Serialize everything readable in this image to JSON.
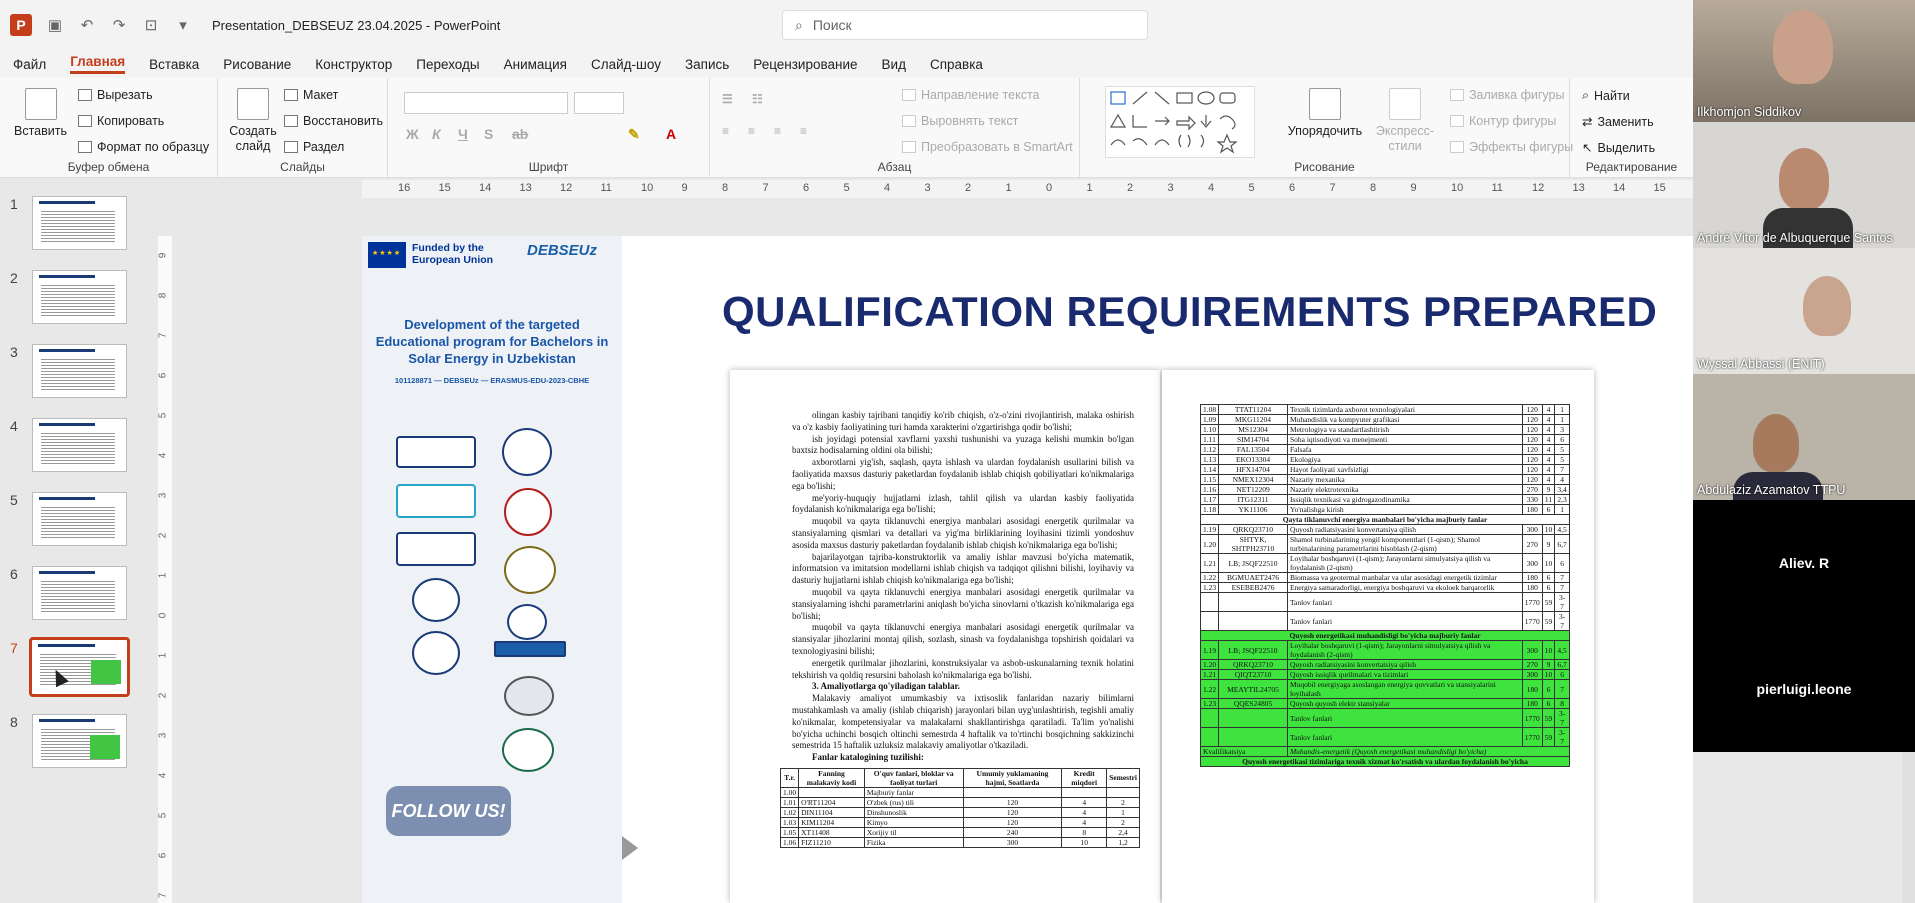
{
  "window": {
    "app_title": "Presentation_DEBSEUZ 23.04.2025  -  PowerPoint",
    "search_placeholder": "Поиск"
  },
  "menu": [
    "Файл",
    "Главная",
    "Вставка",
    "Рисование",
    "Конструктор",
    "Переходы",
    "Анимация",
    "Слайд-шоу",
    "Запись",
    "Рецензирование",
    "Вид",
    "Справка"
  ],
  "ribbon": {
    "clipboard": {
      "paste": "Вставить",
      "cut": "Вырезать",
      "copy": "Копировать",
      "format_painter": "Формат по образцу",
      "group": "Буфер обмена"
    },
    "slides": {
      "new_slide": "Создать слайд",
      "layout": "Макет",
      "reset": "Восстановить",
      "section": "Раздел",
      "group": "Слайды"
    },
    "font": {
      "group": "Шрифт"
    },
    "paragraph": {
      "text_direction": "Направление текста",
      "align_text": "Выровнять текст",
      "smartart": "Преобразовать в SmartArt",
      "group": "Абзац"
    },
    "drawing": {
      "arrange": "Упорядочить",
      "quick_styles": "Экспресс-стили",
      "shape_fill": "Заливка фигуры",
      "shape_outline": "Контур фигуры",
      "shape_effects": "Эффекты фигуры",
      "group": "Рисование"
    },
    "editing": {
      "find": "Найти",
      "replace": "Заменить",
      "select": "Выделить",
      "group": "Редактирование"
    }
  },
  "ruler_h": [
    "16",
    "15",
    "14",
    "13",
    "12",
    "11",
    "10",
    "9",
    "8",
    "7",
    "6",
    "5",
    "4",
    "3",
    "2",
    "1",
    "0",
    "1",
    "2",
    "3",
    "4",
    "5",
    "6",
    "7",
    "8",
    "9",
    "10",
    "11",
    "12",
    "13",
    "14",
    "15",
    "16"
  ],
  "ruler_v": [
    "9",
    "8",
    "7",
    "6",
    "5",
    "4",
    "3",
    "2",
    "1",
    "0",
    "1",
    "2",
    "3",
    "4",
    "5",
    "6",
    "7"
  ],
  "thumbnails": [
    "1",
    "2",
    "3",
    "4",
    "5",
    "6",
    "7",
    "8"
  ],
  "selected_slide": "7",
  "slide": {
    "funded": "Funded by the European Union",
    "brand": "DEBSEUz",
    "project_title": "Development of the targeted Educational program for Bachelors in Solar Energy in Uzbekistan",
    "project_code": "101128871 — DEBSEUz — ERASMUS-EDU-2023-CBHE",
    "follow": "FOLLOW US!",
    "heading": "QUALIFICATION REQUIREMENTS PREPARED",
    "doc_paragraphs": [
      "olingan kasbiy tajribani tanqidiy ko'rib chiqish, o'z-o'zini rivojlantirish, malaka oshirish va o'z kasbiy faoliyatining turi hamda xarakterini o'zgartirishga qodir bo'lishi;",
      "ish joyidagi potensial xavflarni yaxshi tushunishi va yuzaga kelishi mumkin bo'lgan baxtsiz hodisalarning oldini ola bilishi;",
      "axborotlarni yig'ish, saqlash, qayta ishlash va ulardan foydalanish usullarini bilish va faoliyatida maxsus dasturiy paketlardan foydalanib ishlab chiqish qobiliyatlari ko'nikmalariga ega bo'lishi;",
      "me'yoriy-huquqiy hujjatlarni izlash, tahlil qilish va ulardan kasbiy faoliyatida foydalanish ko'nikmalariga ega bo'lishi;",
      "muqobil va qayta tiklanuvchi energiya manbalari asosidagi energetik qurilmalar va stansiyalarning qismlari va detallari va yig'ma birliklarining loyihasini tizimli yondoshuv asosida maxsus dasturiy paketlardan foydalanib ishlab chiqish ko'nikmalariga ega bo'lishi;",
      "bajarilayotgan tajriba-konstruktorlik va amaliy ishlar mavzusi bo'yicha matematik, informatsion va imitatsion modellarni ishlab chiqish va tadqiqot qilishni bilishi, loyihaviy va dasturiy hujjatlarni ishlab chiqish ko'nikmalariga ega bo'lishi;",
      "muqobil va qayta tiklanuvchi energiya manbalari asosidagi energetik qurilmalar va stansiyalarning ishchi parametrlarini aniqlash bo'yicha sinovlarni o'tkazish ko'nikmalariga ega bo'lishi;",
      "muqobil va qayta tiklanuvchi energiya manbalari asosidagi energetik qurilmalar va stansiyalar jihozlarini montaj qilish, sozlash, sinash va foydalanishga topshirish qoidalari va texnologiyasini bilishi;",
      "energetik qurilmalar jihozlarini, konstruksiyalar va asbob-uskunalarning texnik holatini tekshirish va qoldiq resursini baholash ko'nikmalariga ega bo'lishi."
    ],
    "doc_section": "3. Amaliyotlarga qo'yiladigan talablar.",
    "doc_para2": "Malakaviy amaliyot umumkasbiy va ixtisoslik fanlaridan nazariy bilimlarni mustahkamlash va amaliy (ishlab chiqarish) jarayonlari bilan uyg'unlashtirish, tegishli amaliy ko'nikmalar, kompetensiyalar va malakalarni shakllantirishga qaratiladi. Ta'lim yo'nalishi bo'yicha uchinchi bosqich oltinchi semestrda 4 haftalik va to'rtinchi bosqichning sakkizinchi semestrida 15 haftalik uzluksiz malakaviy amaliyotlar o'tkaziladi.",
    "doc_catalog": "Fanlar katalogining tuzilishi:",
    "doc_table_headers": [
      "T.r.",
      "Fanning malakaviy kodi",
      "O'quv fanlari, bloklar va faoliyat turlari",
      "Umumiy yuklamaning hajmi, Soatlarda",
      "Kredit miqdori",
      "Semestri"
    ],
    "doc_table_rows": [
      [
        "1.00",
        "",
        "Majburiy fanlar",
        "",
        "",
        ""
      ],
      [
        "1.01",
        "O'RT11204",
        "O'zbek (rus) tili",
        "120",
        "4",
        "2"
      ],
      [
        "1.02",
        "DIN11104",
        "Dinshunoslik",
        "120",
        "4",
        "1"
      ],
      [
        "1.03",
        "KIM11204",
        "Kimyo",
        "120",
        "4",
        "2"
      ],
      [
        "1.05",
        "XT11408",
        "Xorijiy til",
        "240",
        "8",
        "2,4"
      ],
      [
        "1.06",
        "FIZ11210",
        "Fizika",
        "300",
        "10",
        "1,2"
      ]
    ],
    "table2_rows": [
      {
        "n": "1.08",
        "code": "TTAT11204",
        "name": "Texnik tizimlarda axborot texnologiyalari",
        "h": "120",
        "c": "4",
        "s": "1"
      },
      {
        "n": "1.09",
        "code": "MKG11204",
        "name": "Muhandislik va kompyuter grafikasi",
        "h": "120",
        "c": "4",
        "s": "1"
      },
      {
        "n": "1.10",
        "code": "MS12304",
        "name": "Metrologiya va standartlashtirish",
        "h": "120",
        "c": "4",
        "s": "3"
      },
      {
        "n": "1.11",
        "code": "SIM14704",
        "name": "Soha iqtisodiyoti va menejmenti",
        "h": "120",
        "c": "4",
        "s": "6"
      },
      {
        "n": "1.12",
        "code": "FAL13504",
        "name": "Falsafa",
        "h": "120",
        "c": "4",
        "s": "5"
      },
      {
        "n": "1.13",
        "code": "EKO13304",
        "name": "Ekologiya",
        "h": "120",
        "c": "4",
        "s": "5"
      },
      {
        "n": "1.14",
        "code": "HFX14704",
        "name": "Hayot faoliyati xavfsizligi",
        "h": "120",
        "c": "4",
        "s": "7"
      },
      {
        "n": "1.15",
        "code": "NMEX12304",
        "name": "Nazariy mexanika",
        "h": "120",
        "c": "4",
        "s": "4"
      },
      {
        "n": "1.16",
        "code": "NET12209",
        "name": "Nazariy elektrotexnika",
        "h": "270",
        "c": "9",
        "s": "3,4"
      },
      {
        "n": "1.17",
        "code": "ITG12311",
        "name": "Issiqlik texnikasi va gidrogazodinamika",
        "h": "330",
        "c": "11",
        "s": "2,3"
      },
      {
        "n": "1.18",
        "code": "YK11106",
        "name": "Yo'nalishga kirish",
        "h": "180",
        "c": "6",
        "s": "1"
      }
    ],
    "table2_section1": "Qayta tiklanuvchi energiya manbalari bo'yicha majburiy fanlar",
    "table2_rows_b": [
      {
        "n": "1.19",
        "code": "QRKQ23710",
        "name": "Quyosh radiatsiyasini konvertatsiya qilish",
        "h": "300",
        "c": "10",
        "s": "4,5"
      },
      {
        "n": "1.20",
        "code": "SHTYK, SHTPH23710",
        "name": "Shamol turbinalarining yengil komponentlari (1-qism); Shamol turbinalarining parametrlarini hisoblash (2-qism)",
        "h": "270",
        "c": "9",
        "s": "6,7"
      },
      {
        "n": "1.21",
        "code": "LB; JSQF22510",
        "name": "Loyihalar boshqaruvi (1-qism); Jarayonlarni simulyatsiya qilish va foydalanish (2-qism)",
        "h": "300",
        "c": "10",
        "s": "6"
      },
      {
        "n": "1.22",
        "code": "BGMUAET2476",
        "name": "Biomassa va geotermal manbalar va ular asosidagi energetik tizimlar",
        "h": "180",
        "c": "6",
        "s": "7"
      },
      {
        "n": "1.23",
        "code": "ESEBEB2476",
        "name": "Energiya samaradorligi, energiya boshqaruvi va ekoloek barqarorlik",
        "h": "180",
        "c": "6",
        "s": "7"
      },
      {
        "n": "",
        "code": "",
        "name": "Tanlov fanlari",
        "h": "1770",
        "c": "59",
        "s": "3-7"
      },
      {
        "n": "",
        "code": "",
        "name": "Tanlov fanlari",
        "h": "1770",
        "c": "59",
        "s": "3-7"
      }
    ],
    "table2_section2": "Quyosh energetikasi muhandisligi bo'yicha majburiy fanlar",
    "table2_rows_green": [
      {
        "n": "1.19",
        "code": "LB; JSQF22510",
        "name": "Loyihalar boshqaruvi (1-qism); Jarayonlarni simulyatsiya qilish va foydalanish (2-qism)",
        "h": "300",
        "c": "10",
        "s": "4,5"
      },
      {
        "n": "1.20",
        "code": "QRKQ23710",
        "name": "Quyosh radiatsiyasini konvertatsiya qilish",
        "h": "270",
        "c": "9",
        "s": "6,7"
      },
      {
        "n": "1.21",
        "code": "QIQT23710",
        "name": "Quyosh issiqlik qurilmalari va tizimlari",
        "h": "300",
        "c": "10",
        "s": "6"
      },
      {
        "n": "1.22",
        "code": "MEAYTIL24705",
        "name": "Muqobil energiyaga asoslangan energiya quvvatlari va stansiyalarini loyihalash",
        "h": "180",
        "c": "6",
        "s": "7"
      },
      {
        "n": "1.23",
        "code": "QQES24805",
        "name": "Quyosh quyosh elektr stansiyalar",
        "h": "180",
        "c": "6",
        "s": "8"
      },
      {
        "n": "",
        "code": "",
        "name": "Tanlov fanlari",
        "h": "1770",
        "c": "59",
        "s": "3-7"
      },
      {
        "n": "",
        "code": "",
        "name": "Tanlov fanlari",
        "h": "1770",
        "c": "59",
        "s": "3-7"
      }
    ],
    "table2_footer1": "Kvalifikatsiya",
    "table2_footer1b": "Muhandis-energetik (Quyosh energetikasi muhandisligi bo'yicha)",
    "table2_footer2": "Quyosh energetikasi tizimlariga texnik xizmat ko'rsatish va ulardan foydalanish bo'yicha"
  },
  "participants": [
    {
      "name": "Ilkhomjon Siddikov"
    },
    {
      "name": "André Vitor de Albuquerque Santos"
    },
    {
      "name": "Wyssal Abbassi (ENIT)"
    },
    {
      "name": "Abdulaziz Azamatov TTPU"
    },
    {
      "name": "Aliev. R"
    },
    {
      "name": "pierluigi.leone"
    }
  ],
  "colors": {
    "accent": "#c43e1c",
    "heading": "#1a2a6e",
    "highlight": "#3ee33e"
  }
}
